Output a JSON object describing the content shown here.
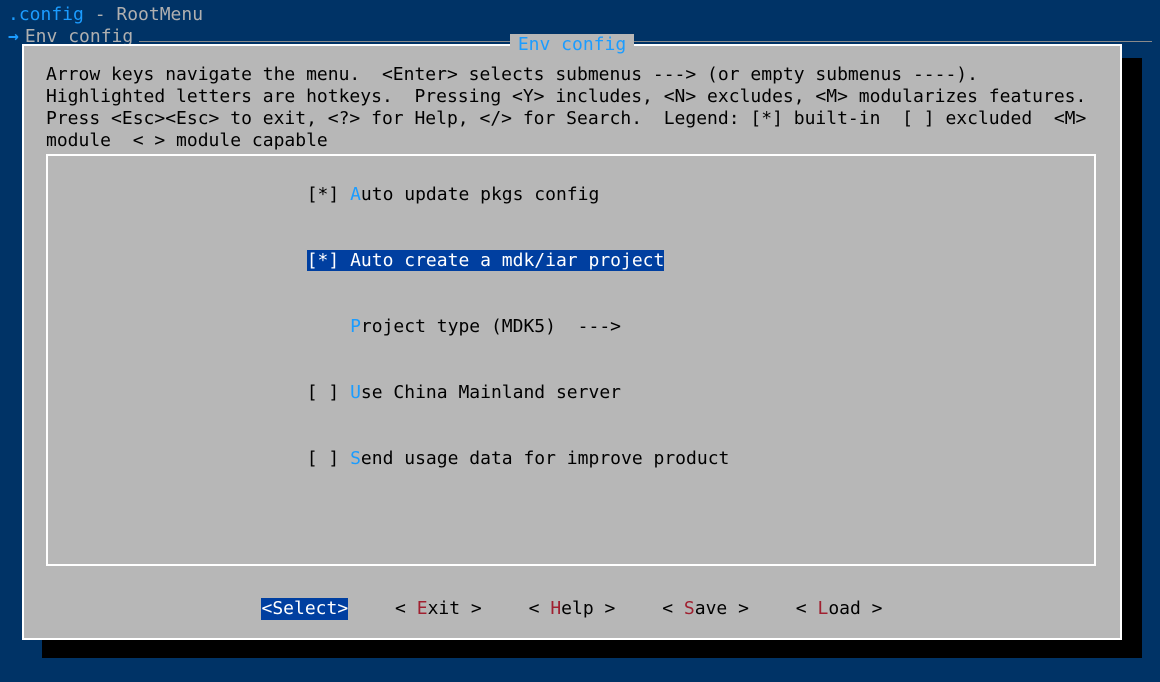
{
  "header": {
    "config_label": ".config",
    "root_menu": "RootMenu",
    "sep": " - ",
    "breadcrumb_arrow": "→",
    "breadcrumb": "Env config"
  },
  "panel": {
    "title": "Env config",
    "instructions": "Arrow keys navigate the menu.  <Enter> selects submenus ---> (or empty submenus ----).  Highlighted letters are hotkeys.  Pressing <Y> includes, <N> excludes, <M> modularizes features.  Press <Esc><Esc> to exit, <?> for Help, </> for Search.  Legend: [*] built-in  [ ] excluded  <M> module  < > module capable"
  },
  "menu": [
    {
      "marker": "[*]",
      "hot": "A",
      "rest": "uto update pkgs config",
      "highlight": false,
      "indent": 0
    },
    {
      "marker": "[*]",
      "hot": "A",
      "rest": "uto create a mdk/iar project",
      "highlight": true,
      "indent": 0
    },
    {
      "marker": "",
      "hot": "P",
      "rest": "roject type (MDK5)  --->",
      "highlight": false,
      "indent": 1
    },
    {
      "marker": "[ ]",
      "hot": "U",
      "rest": "se China Mainland server",
      "highlight": false,
      "indent": 0
    },
    {
      "marker": "[ ]",
      "hot": "S",
      "rest": "end usage data for improve product",
      "highlight": false,
      "indent": 0
    }
  ],
  "buttons": {
    "select": {
      "open": "<",
      "hot": "S",
      "rest": "elect",
      "close": ">",
      "active": true
    },
    "exit": {
      "open": "< ",
      "hot": "E",
      "rest": "xit",
      "close": " >",
      "active": false
    },
    "help": {
      "open": "< ",
      "hot": "H",
      "rest": "elp",
      "close": " >",
      "active": false
    },
    "save": {
      "open": "< ",
      "hot": "S",
      "rest": "ave",
      "close": " >",
      "active": false
    },
    "load": {
      "open": "< ",
      "hot": "L",
      "rest": "oad",
      "close": " >",
      "active": false
    }
  }
}
